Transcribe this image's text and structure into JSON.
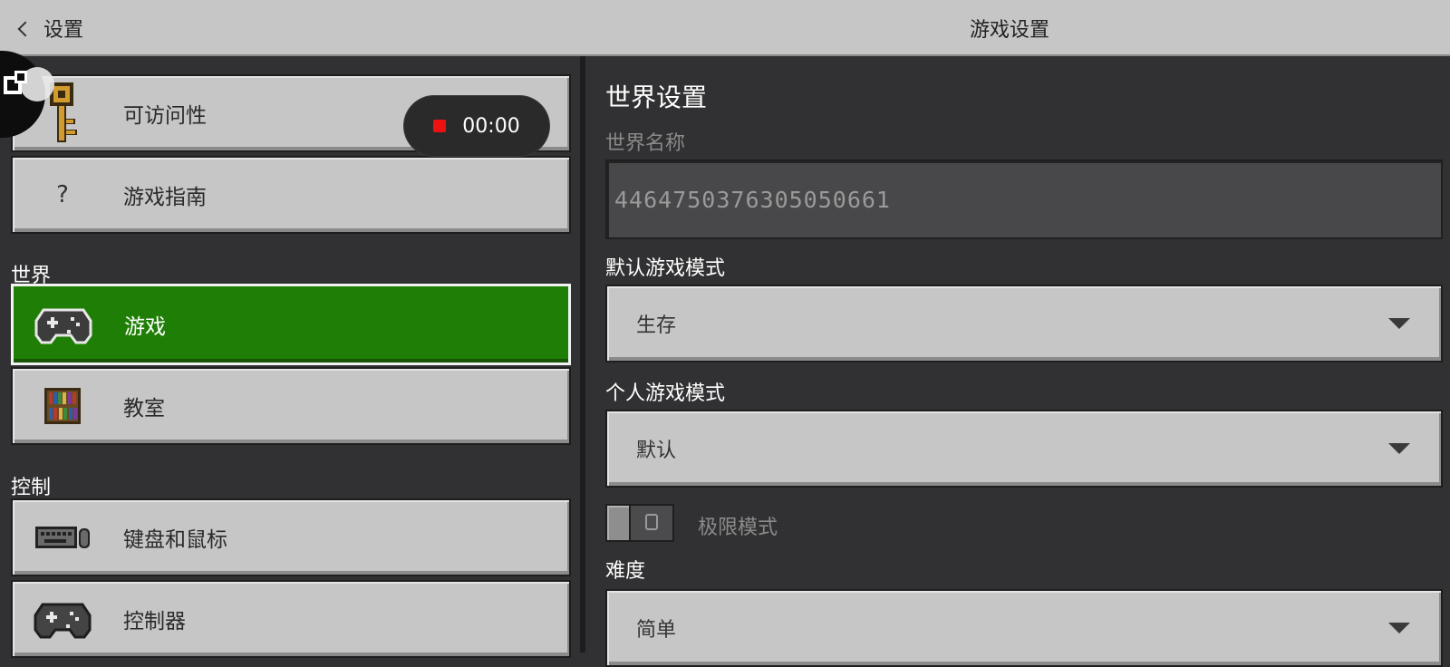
{
  "topbar": {
    "back_label": "设置",
    "title": "游戏设置"
  },
  "recorder": {
    "time": "00:00"
  },
  "left": {
    "items_general": [
      {
        "label": "可访问性",
        "icon": "key-icon"
      },
      {
        "label": "游戏指南",
        "icon": "question-icon",
        "glyph": "?"
      }
    ],
    "section_world": "世界",
    "items_world": [
      {
        "label": "游戏",
        "icon": "gamepad-icon",
        "active": true
      },
      {
        "label": "教室",
        "icon": "bookshelf-icon"
      }
    ],
    "section_controls": "控制",
    "items_controls": [
      {
        "label": "键盘和鼠标",
        "icon": "keyboard-icon"
      },
      {
        "label": "控制器",
        "icon": "gamepad-icon"
      }
    ]
  },
  "right": {
    "heading": "世界设置",
    "world_name_label": "世界名称",
    "world_name_value": "4464750376305050661",
    "default_mode_label": "默认游戏模式",
    "default_mode_value": "生存",
    "personal_mode_label": "个人游戏模式",
    "personal_mode_value": "默认",
    "hardcore_label": "极限模式",
    "hardcore_on": false,
    "difficulty_label": "难度",
    "difficulty_value": "简单"
  },
  "colors": {
    "accent_green": "#1f7e05",
    "panel": "#c6c6c6",
    "background": "#313133"
  }
}
